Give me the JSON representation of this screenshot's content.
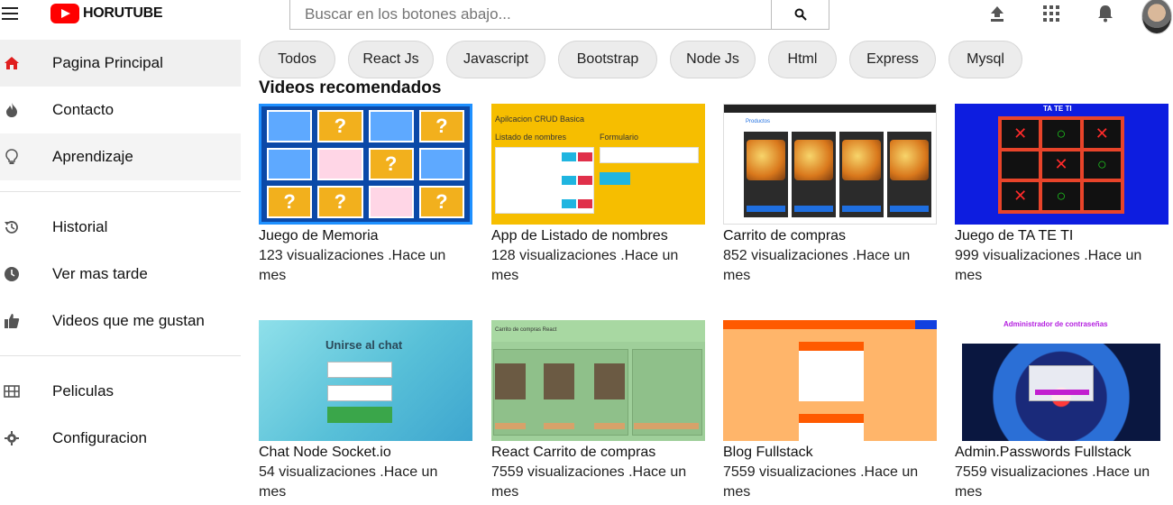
{
  "header": {
    "logo_text": "HORUTUBE",
    "search_placeholder": "Buscar en los botones abajo...",
    "icons": [
      "menu-icon",
      "upload-icon",
      "apps-icon",
      "notifications-icon"
    ]
  },
  "sidebar": {
    "items": [
      {
        "label": "Pagina Principal",
        "icon": "home-icon"
      },
      {
        "label": "Contacto",
        "icon": "fire-icon"
      },
      {
        "label": "Aprendizaje",
        "icon": "lightbulb-icon"
      },
      {
        "label": "Historial",
        "icon": "history-icon"
      },
      {
        "label": "Ver mas tarde",
        "icon": "clock-icon"
      },
      {
        "label": "Videos que me gustan",
        "icon": "thumbs-up-icon"
      },
      {
        "label": "Peliculas",
        "icon": "film-icon"
      },
      {
        "label": "Configuracion",
        "icon": "gear-icon"
      }
    ]
  },
  "chips": [
    "Todos",
    "React Js",
    "Javascript",
    "Bootstrap",
    "Node Js",
    "Html",
    "Express",
    "Mysql"
  ],
  "main": {
    "section_title": "Videos recomendados",
    "videos": [
      {
        "title": "Juego de Memoria",
        "meta1": "123 visualizaciones .Hace un",
        "meta2": "mes"
      },
      {
        "title": "App de Listado de nombres",
        "meta1": "128 visualizaciones .Hace un",
        "meta2": "mes"
      },
      {
        "title": "Carrito de compras",
        "meta1": "852 visualizaciones .Hace un",
        "meta2": "mes"
      },
      {
        "title": "Juego de TA TE TI",
        "meta1": "999 visualizaciones .Hace un",
        "meta2": "mes"
      },
      {
        "title": "Chat Node Socket.io",
        "meta1": "54 visualizaciones .Hace un",
        "meta2": "mes"
      },
      {
        "title": "React Carrito de compras",
        "meta1": "7559 visualizaciones .Hace un",
        "meta2": "mes"
      },
      {
        "title": "Blog Fullstack",
        "meta1": "7559 visualizaciones .Hace un",
        "meta2": "mes"
      },
      {
        "title": "Admin.Passwords Fullstack",
        "meta1": "7559 visualizaciones .Hace un",
        "meta2": "mes"
      }
    ],
    "thumb_texts": {
      "crud_title": "Apilcacion CRUD Basica",
      "crud_list": "Listado de nombres",
      "crud_form": "Formulario",
      "cart_products": "Productos",
      "ttt_title": "TA TE TI",
      "chat_title": "Unirse al chat",
      "react_cart_title": "Carrito de compras React",
      "admin_title": "Administrador de contraseñas"
    }
  },
  "colors": {
    "brand_red": "#ff0000",
    "active_bg": "#f0f0f0",
    "chip_bg": "#ececec"
  }
}
